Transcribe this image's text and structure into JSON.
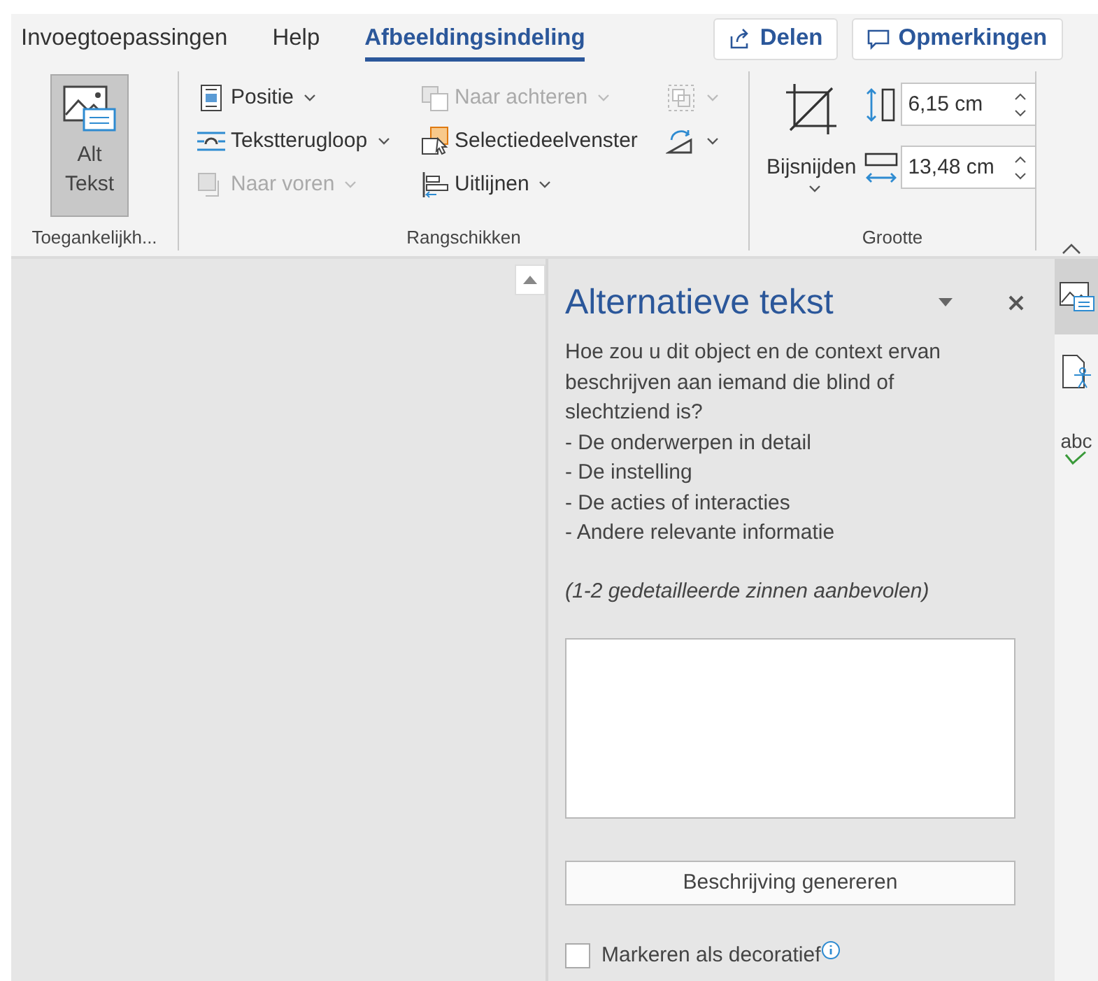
{
  "tabs": [
    {
      "label": "Invoegtoepassingen",
      "selected": false
    },
    {
      "label": "Help",
      "selected": false
    },
    {
      "label": "Afbeeldingsindeling",
      "selected": true
    }
  ],
  "top_buttons": [
    {
      "kind": "share",
      "label": "Delen"
    },
    {
      "kind": "comments",
      "label": "Opmerkingen"
    }
  ],
  "accessibility_group": {
    "label": "Toegankelijkh...",
    "alt_text_button": {
      "label": "Alt Tekst",
      "selected": true
    }
  },
  "arrange_group": {
    "label": "Rangschikken",
    "columns": [
      [
        {
          "kind": "position",
          "label": "Positie",
          "disabled": false
        },
        {
          "kind": "wrap",
          "label": "Tekstterugloop",
          "disabled": false
        },
        {
          "kind": "forward",
          "label": "Naar voren",
          "disabled": true
        }
      ],
      [
        {
          "kind": "backward",
          "label": "Naar achteren",
          "disabled": true
        },
        {
          "kind": "selection",
          "label": "Selectiedeelvenster",
          "disabled": false
        },
        {
          "kind": "align",
          "label": "Uitlijnen",
          "disabled": false
        }
      ],
      [
        {
          "kind": "group",
          "disabled": true
        },
        {
          "kind": "rotate",
          "disabled": false
        }
      ]
    ]
  },
  "size_group": {
    "label": "Grootte",
    "crop_label": "Bijsnijden",
    "height": "6,15 cm",
    "width": "13,48 cm"
  },
  "pane": {
    "title": "Alternatieve tekst",
    "intro": "Hoe zou u dit object en de context ervan beschrijven aan iemand die blind of slechtziend is?",
    "bullets": [
      "- De onderwerpen in detail",
      "- De instelling",
      "- De acties of interacties",
      "- Andere relevante informatie"
    ],
    "hint": "(1-2 gedetailleerde zinnen aanbevolen)",
    "generate_button": "Beschrijving genereren",
    "decorative": {
      "label": "Markeren als decoratief",
      "checked": false
    }
  },
  "side_icons": [
    {
      "kind": "alt-text",
      "selected": true
    },
    {
      "kind": "accessibility",
      "selected": false
    },
    {
      "kind": "spelling",
      "label": "abc",
      "selected": false
    }
  ]
}
